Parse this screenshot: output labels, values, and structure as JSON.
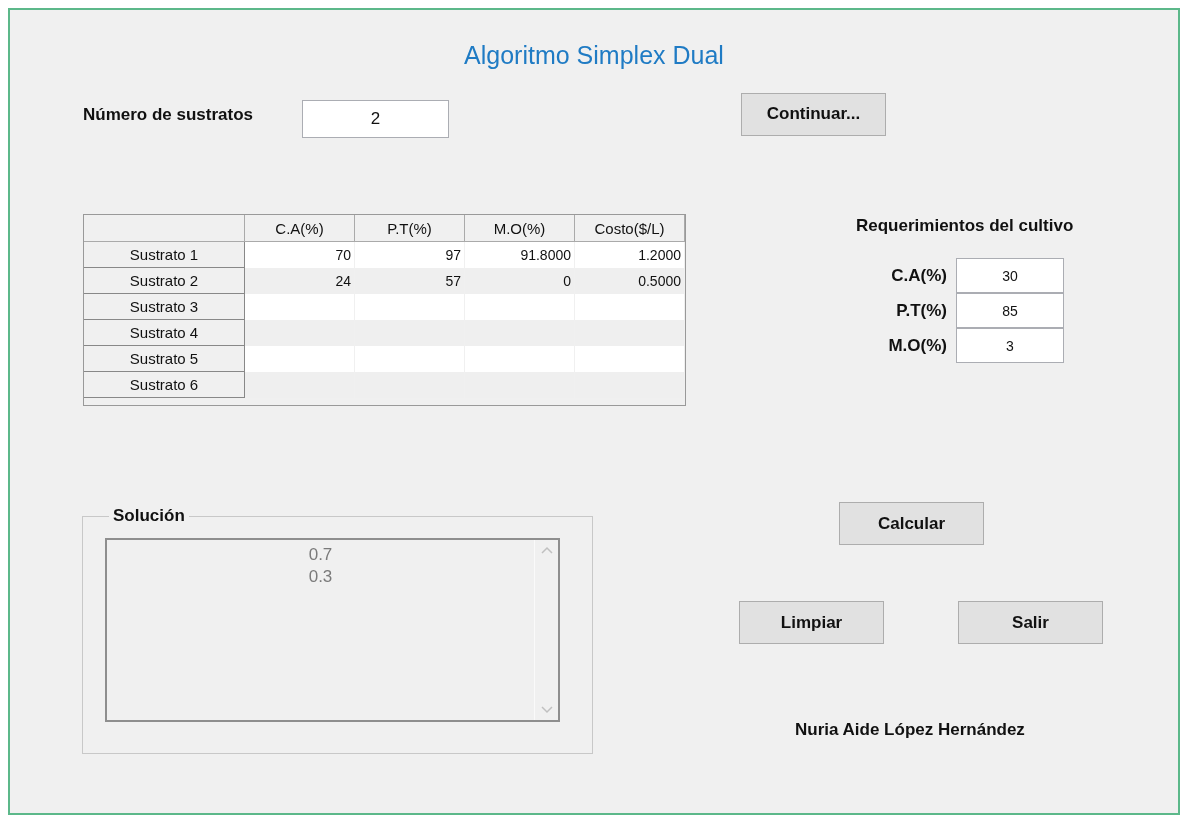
{
  "title": "Algoritmo Simplex Dual",
  "substrates": {
    "label": "Número de sustratos",
    "value": "2"
  },
  "continue_button": "Continuar...",
  "table": {
    "columns": [
      "C.A(%)",
      "P.T(%)",
      "M.O(%)",
      "Costo($/L)"
    ],
    "rows": [
      {
        "header": "Sustrato 1",
        "cells": [
          "70",
          "97",
          "91.8000",
          "1.2000"
        ]
      },
      {
        "header": "Sustrato 2",
        "cells": [
          "24",
          "57",
          "0",
          "0.5000"
        ]
      },
      {
        "header": "Sustrato 3"
      },
      {
        "header": "Sustrato 4"
      },
      {
        "header": "Sustrato 5"
      },
      {
        "header": "Sustrato 6"
      }
    ]
  },
  "requirements": {
    "title": "Requerimientos del cultivo",
    "fields": [
      {
        "label": "C.A(%)",
        "value": "30"
      },
      {
        "label": "P.T(%)",
        "value": "85"
      },
      {
        "label": "M.O(%)",
        "value": "3"
      }
    ]
  },
  "solution": {
    "title": "Solución",
    "lines": [
      "0.7",
      "0.3"
    ]
  },
  "calculate_button": "Calcular",
  "clear_button": "Limpiar",
  "exit_button": "Salir",
  "author": "Nuria Aide López Hernández"
}
